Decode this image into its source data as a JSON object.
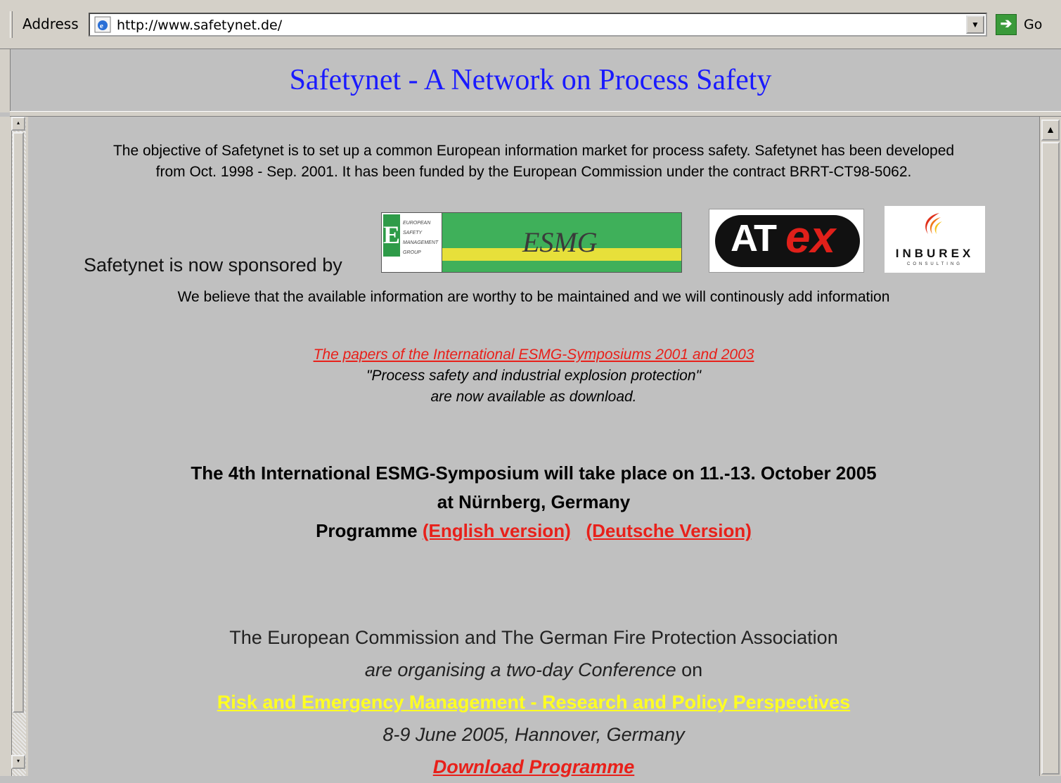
{
  "browser": {
    "address_label": "Address",
    "url": "http://www.safetynet.de/",
    "go_label": "Go"
  },
  "page": {
    "title": "Safetynet - A Network on Process Safety",
    "objective_line1": "The objective of Safetynet is to set up a common European information market for process safety. Safetynet has been developed",
    "objective_line2": "from Oct. 1998 - Sep. 2001. It has been funded by the European Commission under the contract BRRT-CT98-5062.",
    "sponsor_label": "Safetynet is now sponsored by",
    "sponsors": {
      "esmg": "ESMG",
      "esmg_small": [
        "EUROPEAN",
        "SAFETY",
        "MANAGEMENT",
        "GROUP"
      ],
      "atex_at": "AT",
      "atex_ex": "ex",
      "inburex": "INBUREX",
      "inburex_sub": "CONSULTING"
    },
    "believe": "We believe that the available information are worthy to be maintained and we will continously add information",
    "papers_link": "The papers of the International ESMG-Symposiums 2001 and 2003",
    "papers_line2": "\"Process safety and industrial explosion protection\"",
    "papers_line3": "are now available as download.",
    "symposium_line1": "The 4th International ESMG-Symposium will take place on 11.-13. October 2005",
    "symposium_line2": "at Nürnberg, Germany",
    "programme_label": "Programme",
    "english_link": "(English version)",
    "deutsche_link": "(Deutsche Version)",
    "conf_line1": "The European Commission  and  The German Fire Protection Association",
    "conf_line2_italic": "are organising a two-day Conference",
    "conf_line2_tail": " on",
    "conf_link": "Risk and Emergency Management - Research and Policy Perspectives",
    "conf_date": "8-9 June 2005, Hannover, Germany",
    "download_link": "Download Programme"
  }
}
